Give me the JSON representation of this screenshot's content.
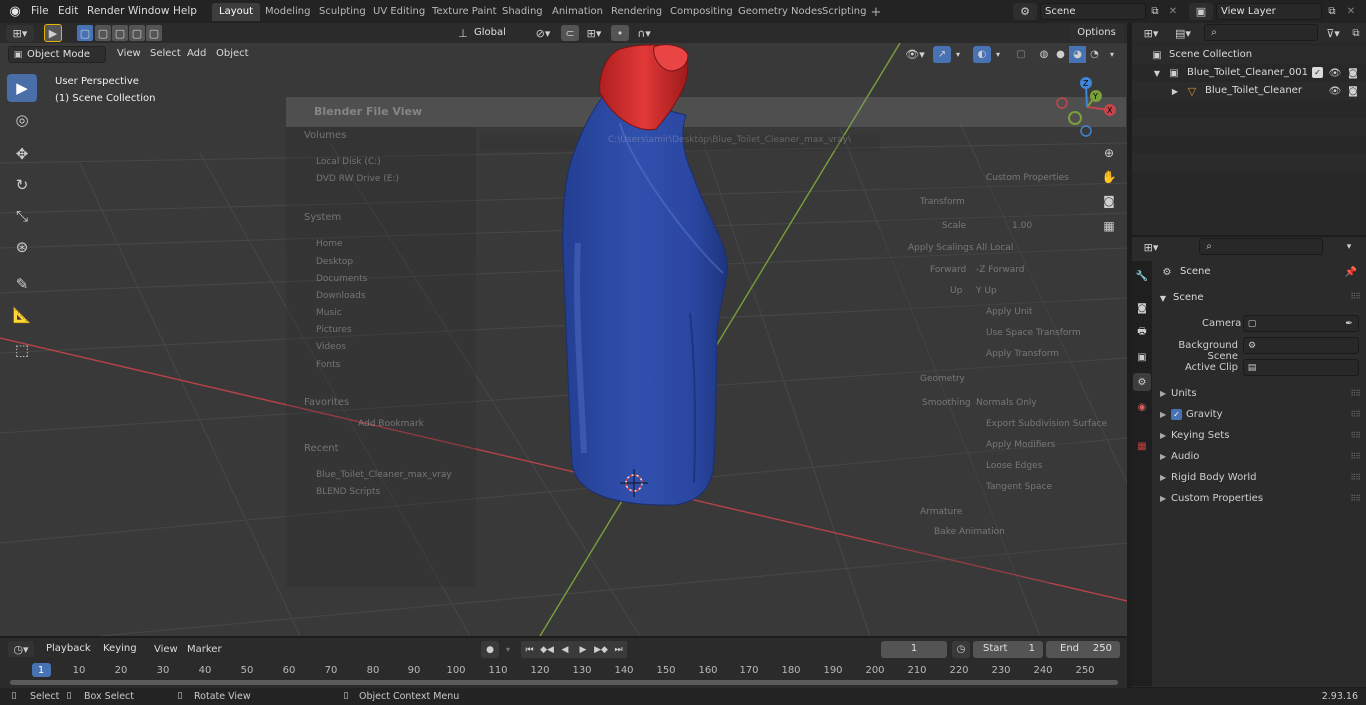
{
  "app": {
    "version": "2.93.16"
  },
  "menus": [
    "File",
    "Edit",
    "Render",
    "Window",
    "Help"
  ],
  "workspaces": [
    "Layout",
    "Modeling",
    "Sculpting",
    "UV Editing",
    "Texture Paint",
    "Shading",
    "Animation",
    "Rendering",
    "Compositing",
    "Geometry Nodes",
    "Scripting"
  ],
  "active_workspace": "Layout",
  "scene_selector": "Scene",
  "view_layer_selector": "View Layer",
  "header": {
    "transform_orientation": "Global",
    "options": "Options"
  },
  "viewport_header": {
    "mode": "Object Mode",
    "menus": [
      "View",
      "Select",
      "Add",
      "Object"
    ]
  },
  "viewport": {
    "perspective_label": "User Perspective",
    "collection_label": "(1) Scene Collection"
  },
  "file_view_overlay": {
    "title": "Blender File View",
    "path": "C:\\Users\\amir\\Desktop\\Blue_Toilet_Cleaner_max_vray\\",
    "sections": [
      {
        "name": "Volumes",
        "items": [
          "Local Disk (C:)",
          "DVD RW Drive (E:)"
        ]
      },
      {
        "name": "System",
        "items": [
          "Home",
          "Desktop",
          "Documents",
          "Downloads",
          "Music",
          "Pictures",
          "Videos",
          "Fonts"
        ]
      },
      {
        "name": "Favorites",
        "items": [
          "Add Bookmark"
        ]
      },
      {
        "name": "Recent",
        "items": [
          "Blue_Toilet_Cleaner_max_vray",
          "BLEND Scripts"
        ]
      }
    ],
    "right_panel": {
      "custom_properties": "Custom Properties",
      "transform": "Transform",
      "scale_label": "Scale",
      "scale_value": "1.00",
      "apply_scalings_label": "Apply Scalings",
      "apply_scalings_value": "All Local",
      "forward_label": "Forward",
      "forward_value": "-Z Forward",
      "up_label": "Up",
      "up_value": "Y Up",
      "checks": [
        "Apply Unit",
        "Use Space Transform",
        "Apply Transform"
      ],
      "geometry": "Geometry",
      "smoothing_label": "Smoothing",
      "smoothing_value": "Normals Only",
      "geo_checks": [
        "Export Subdivision Surface",
        "Apply Modifiers",
        "Loose Edges",
        "Tangent Space"
      ],
      "armature": "Armature",
      "bake_animation": "Bake Animation"
    }
  },
  "outliner": {
    "root": "Scene Collection",
    "items": [
      {
        "label": "Blue_Toilet_Cleaner_001",
        "level": 1
      },
      {
        "label": "Blue_Toilet_Cleaner",
        "level": 2
      }
    ]
  },
  "properties": {
    "title": "Scene",
    "section": "Scene",
    "camera_label": "Camera",
    "background_scene_label": "Background Scene",
    "active_clip_label": "Active Clip",
    "panels": [
      "Units",
      "Gravity",
      "Keying Sets",
      "Audio",
      "Rigid Body World",
      "Custom Properties"
    ],
    "gravity_checked": true
  },
  "timeline": {
    "menus": [
      "Playback",
      "Keying",
      "View",
      "Marker"
    ],
    "current_frame": "1",
    "start_label": "Start",
    "start": "1",
    "end_label": "End",
    "end": "250",
    "ticks": [
      "1",
      "10",
      "20",
      "30",
      "40",
      "50",
      "60",
      "70",
      "80",
      "90",
      "100",
      "110",
      "120",
      "130",
      "140",
      "150",
      "160",
      "170",
      "180",
      "190",
      "200",
      "210",
      "220",
      "230",
      "240",
      "250"
    ]
  },
  "statusbar": {
    "select": "Select",
    "box_select": "Box Select",
    "rotate_view": "Rotate View",
    "context_menu": "Object Context Menu"
  },
  "colors": {
    "accent": "#4772b3",
    "bottle": "#2b4ba8",
    "cap": "#d22a2a",
    "axis_x": "#c8444c",
    "axis_y": "#7aa03a",
    "axis_z": "#3f86d6",
    "header": "#232323"
  }
}
